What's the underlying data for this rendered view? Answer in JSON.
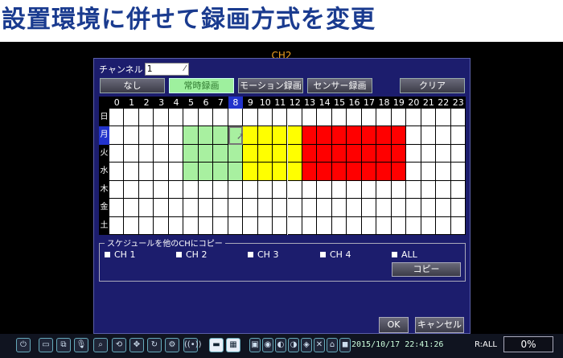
{
  "heading": "設置環境に併せて録画方式を変更",
  "window": {
    "title": "CH2"
  },
  "channel": {
    "label": "チャンネル",
    "value": "1"
  },
  "modes": [
    {
      "label": "なし",
      "active": false
    },
    {
      "label": "常時録画",
      "active": true
    },
    {
      "label": "モーション録画",
      "active": false
    },
    {
      "label": "センサー録画",
      "active": false
    }
  ],
  "clear_label": "クリア",
  "hours": [
    "0",
    "1",
    "2",
    "3",
    "4",
    "5",
    "6",
    "7",
    "8",
    "9",
    "10",
    "11",
    "12",
    "13",
    "14",
    "15",
    "16",
    "17",
    "18",
    "19",
    "20",
    "21",
    "22",
    "23"
  ],
  "selected_hour": 8,
  "days": [
    "日",
    "月",
    "火",
    "水",
    "木",
    "金",
    "土"
  ],
  "selected_day": 1,
  "schedule_legend": {
    "none": "#ffffff",
    "continuous": "#a8f0a0",
    "motion": "#ffff00",
    "sensor": "#ff0000"
  },
  "schedule": [
    "nnnnnnnnnnnnnnnnnnnnnnnn",
    "nnnnnccccmmmmsssssssnnnn",
    "nnnnnccccmmmmsssssssnnnn",
    "nnnnnccccmmmmsssssssnnnn",
    "nnnnnnnnnnnnnnnnnnnnnnnn",
    "nnnnnnnnnnnnnnnnnnnnnnnn",
    "nnnnnnnnnnnnnnnnnnnnnnnn"
  ],
  "copy": {
    "legend": "スケジュールを他のCHにコピー",
    "options": [
      "CH 1",
      "CH 2",
      "CH 3",
      "CH 4",
      "ALL"
    ],
    "button": "コピー"
  },
  "ok_label": "OK",
  "cancel_label": "キャンセル",
  "taskbar": {
    "icons": [
      "power-icon",
      "record-icon",
      "search-record-icon",
      "mic-icon",
      "zoom-icon",
      "playback-icon",
      "ptz-icon",
      "sequence-icon",
      "settings-icon",
      "wifi-icon",
      "single-view-icon",
      "quad-view-icon"
    ],
    "status_icons": [
      "status-icon-1",
      "status-icon-2",
      "status-icon-3",
      "status-icon-4",
      "status-icon-5",
      "status-icon-6",
      "status-icon-7",
      "status-icon-8"
    ],
    "datetime": "2015/10/17 22:41:26",
    "record_status": "R:ALL",
    "hdd_percent": "0%"
  }
}
